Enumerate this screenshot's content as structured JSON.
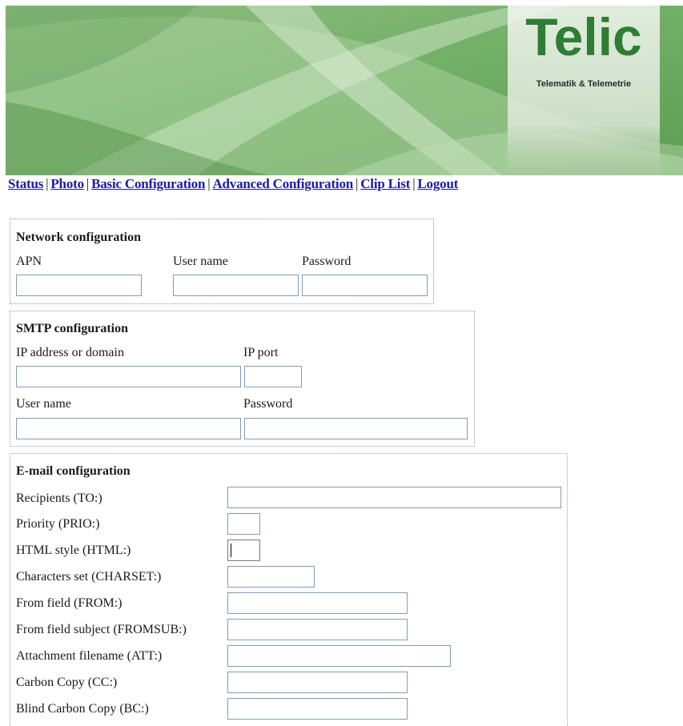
{
  "brand": {
    "logo_text": "Telic",
    "tagline": "Telematik & Telemetrie",
    "logo_color": "#2f7d34"
  },
  "nav": {
    "links": [
      "Status",
      "Photo",
      "Basic Configuration",
      "Advanced Configuration",
      "Clip List",
      "Logout"
    ],
    "separator": "|",
    "link_color": "#1a1aa6"
  },
  "network": {
    "title": "Network configuration",
    "apn_label": "APN",
    "apn_value": "",
    "user_label": "User name",
    "user_value": "",
    "pass_label": "Password",
    "pass_value": ""
  },
  "smtp": {
    "title": "SMTP configuration",
    "host_label": "IP address or domain",
    "host_value": "",
    "port_label": "IP port",
    "port_value": "",
    "user_label": "User name",
    "user_value": "",
    "pass_label": "Password",
    "pass_value": ""
  },
  "email": {
    "title": "E-mail configuration",
    "to_label": "Recipients (TO:)",
    "to_value": "",
    "prio_label": "Priority (PRIO:)",
    "prio_value": "",
    "html_label": "HTML style (HTML:)",
    "html_value": "",
    "charset_label": "Characters set (CHARSET:)",
    "charset_value": "",
    "from_label": "From field (FROM:)",
    "from_value": "",
    "fromsub_label": "From field subject (FROMSUB:)",
    "fromsub_value": "",
    "att_label": "Attachment filename (ATT:)",
    "att_value": "",
    "cc_label": "Carbon Copy (CC:)",
    "cc_value": "",
    "bc_label": "Blind Carbon Copy (BC:)",
    "bc_value": ""
  }
}
